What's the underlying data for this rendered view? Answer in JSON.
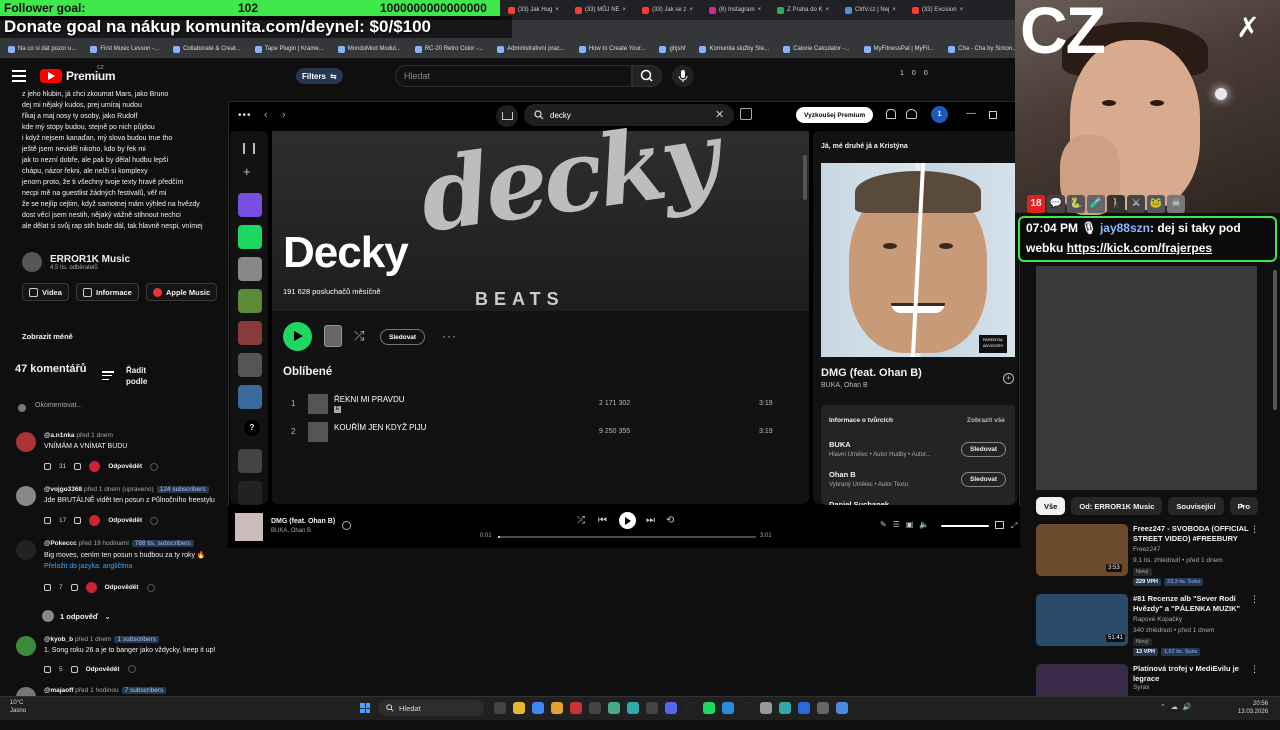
{
  "overlay": {
    "follower_goal_label": "Follower goal:",
    "follower_current": "102",
    "follower_target": "1000000000000000",
    "donate_text": "Donate goal na nákup komunita.com/deynel: $0/$100",
    "cam_logo_text": "CZ",
    "emotes": [
      "18",
      "💬",
      "🐍",
      "🧪",
      "🚶",
      "⚔",
      "🐸",
      "☠"
    ]
  },
  "chat": {
    "time": "07:04 PM",
    "user": "jay88szn",
    "message": ": dej si taky pod",
    "message_prefix": "webku ",
    "link": "https://kick.com/frajerpes"
  },
  "browser": {
    "tabs": [
      "(33) Jak Hug",
      "(33) MŮJ NE",
      "(33) Jak se z",
      "(8) Instagram",
      "Z Praha do K",
      "CtrlV.cz | Nej",
      "(33) Excision"
    ],
    "tab_colors": [
      "#ff3b30",
      "#ff3b30",
      "#ff3b30",
      "#d6249f",
      "#34a853",
      "#4a90d9",
      "#ff3b30"
    ],
    "bookmarks": [
      "Na co si dát pozor u...",
      "First Music Lesson -...",
      "Collaborate & Creat...",
      "Tape Plugin | Krame...",
      "MondoMod Modul...",
      "RC-20 Retro Color -...",
      "Administrativní prac...",
      "How to Create Your...",
      "ghjshf",
      "Komunita služby Ste...",
      "Calorie Calculator -...",
      "MyFitnessPal | MyFit...",
      "Cha - Cha by Simon...",
      "Hype"
    ]
  },
  "youtube": {
    "logo": "Premium",
    "region": "CZ",
    "filters_label": "Filters",
    "search_placeholder": "Hledat",
    "header_counts": [
      "1",
      "0",
      "0"
    ],
    "description_lines": [
      "z jeho hlubin, já chci zkoumat Mars, jako Bruno",
      "dej mi nějaký kudos, prej umíraj nudou",
      "říkaj a maj nosy ty osoby, jako Rudolf",
      "kde mý stopy budou, stejně po nich půjdou",
      "i když nejsem kanaďan, mý slova budou true tho",
      "ještě jsem neviděl nikoho, kdo by řek mi",
      "jak to nezní dobře, ale pak by dělal hudbu lepší",
      "chápu, názor řekni, ale nelži si komplexy",
      "jenom proto, že ti všechny tvoje texty hravě předčím",
      "necpi mě na guestlist žádných festivalů, věř mi",
      "že se nejlíp cejtim, když samotnej mám výhled na hvězdy",
      "dost věcí jsem nestih, nějaký vážně stihnout nechci",
      "ale dělat si svůj rap stih bude dál, tak hlavně nespi, vnímej"
    ],
    "channel_name": "ERROR1K Music",
    "channel_subs": "4,5 tis. odběratelů",
    "channel_buttons": [
      "Videa",
      "Informace",
      "Apple Music"
    ],
    "show_less": "Zobrazit méně",
    "comments_count": "47 komentářů",
    "sort_label": "Řadit podle",
    "add_comment": "Okomentovat...",
    "reply_label": "Odpovědět",
    "translate_label": "Přeložit do jazyka: angličtina",
    "replies_label": "1 odpověď",
    "comments": [
      {
        "user": "@a.n1nka",
        "time": "před 1 dnem",
        "badge": "",
        "text": "VNÍMÁM A VNÍMAT BUDU",
        "likes": "31",
        "avatar": "#a33"
      },
      {
        "user": "@vojgo3368",
        "time": "před 1 dnem (upraveno)",
        "badge": "124 subscribers",
        "text": "Jde BRUTÁLNĚ vidět ten posun z Půlnočního freestylu",
        "likes": "17",
        "avatar": "#888"
      },
      {
        "user": "@Pokeccc",
        "time": "před 19 hodinami",
        "badge": "788 tis. subscribers",
        "text": "Big moves, cením ten posun s hudbou za ty roky 🔥",
        "likes": "7",
        "avatar": "#222"
      },
      {
        "user": "@kyob_b",
        "time": "před 1 dnem",
        "badge": "1 subscribers",
        "text": "1. Song roku 26 a je to banger jako vždycky, keep it up!",
        "likes": "5",
        "avatar": "#3a8a3a"
      },
      {
        "user": "@majaoff",
        "time": "před 1 hodinou",
        "badge": "7 subscribers",
        "text": "",
        "likes": "",
        "avatar": "#777"
      }
    ],
    "chips": [
      "Vše",
      "Od: ERROR1K Music",
      "Související",
      "Pro"
    ],
    "recommendations": [
      {
        "title": "Freez247 - SVOBODA (OFFICIAL STREET VIDEO) #FREEBURY",
        "channel": "Freez247",
        "meta": "9,1 tis. zhlédnutí • před 1 dnem",
        "badge": "Nový",
        "vph": "229 VPH",
        "subs": "23,3 tis. Subs",
        "duration": "3:53",
        "thumb": "#6a4a2a"
      },
      {
        "title": "#81 Recenze alb \"Sever Rodí Hvězdy\" a \"PÁLENKA MUZIK\"",
        "channel": "Rapové Kopačky",
        "meta": "340 zhlédnutí • před 1 dnem",
        "badge": "Nový",
        "vph": "13 VPH",
        "subs": "1,62 tis. Subs",
        "duration": "51:41",
        "thumb": "#2a4a6a"
      },
      {
        "title": "Platinová trofej v MediEvilu je legrace",
        "channel": "Syrax",
        "meta": "",
        "badge": "",
        "vph": "",
        "subs": "",
        "duration": "",
        "thumb": "#3a2a4a"
      }
    ]
  },
  "spotify": {
    "search_value": "decky",
    "premium_button": "Vyzkoušej Premium",
    "user_initial": "1",
    "artist_name": "Decky",
    "banner_script": "decky",
    "banner_sub": "BEATS",
    "monthly_listeners": "191 628 posluchačů měsíčně",
    "follow_button": "Sledovat",
    "popular_title": "Oblíbené",
    "tracks": [
      {
        "num": "1",
        "title": "ŘEKNI MI PRAVDU",
        "explicit": "E",
        "plays": "2 171 302",
        "duration": "3:19"
      },
      {
        "num": "2",
        "title": "KOUŘÍM JEN KDYŽ PIJU",
        "explicit": "",
        "plays": "9 250 355",
        "duration": "3:19"
      }
    ],
    "now_playing_header": "Já, mé druhé já a Kristýna",
    "now_playing_title": "DMG (feat. Ohan B)",
    "now_playing_artist": "BUKA, Ohan B",
    "parental_advisory": "PARENTAL ADVISORY",
    "credits_title": "Informace o tvůrcích",
    "credits_show_all": "Zobrazit vše",
    "credits": [
      {
        "name": "BUKA",
        "role": "Hlavní Umělec • Autor Hudby • Autor..."
      },
      {
        "name": "Ohan B",
        "role": "Vybraný Umělec • Autor Textu"
      },
      {
        "name": "Daniel Suchanek",
        "role": ""
      }
    ],
    "player": {
      "title": "DMG (feat. Ohan B)",
      "artist": "BUKA, Ohan B",
      "current_time": "0:01",
      "total_time": "3:01",
      "progress": 0.006
    },
    "library_colors": [
      "#7a4ee0",
      "#1ed760",
      "#888",
      "#5a8a3a",
      "#8a3a3a",
      "#555",
      "#3a6a9a",
      "#444",
      "#222",
      "#2a5ab8",
      "#b8503a"
    ]
  },
  "taskbar": {
    "weather_temp": "10°C",
    "weather_desc": "Jasno",
    "search_placeholder": "Hledat",
    "time": "20:56",
    "date": "13.03.2026",
    "app_colors": [
      "#444",
      "#e8b830",
      "#4285f4",
      "#e8a030",
      "#c33",
      "#444",
      "#4a8",
      "#3aa",
      "#444",
      "#5865f2",
      "#222",
      "#1ed760",
      "#2a8ae0",
      "#222",
      "#999",
      "#3aa",
      "#2a6ae0",
      "#666",
      "#4a8ae0"
    ]
  }
}
